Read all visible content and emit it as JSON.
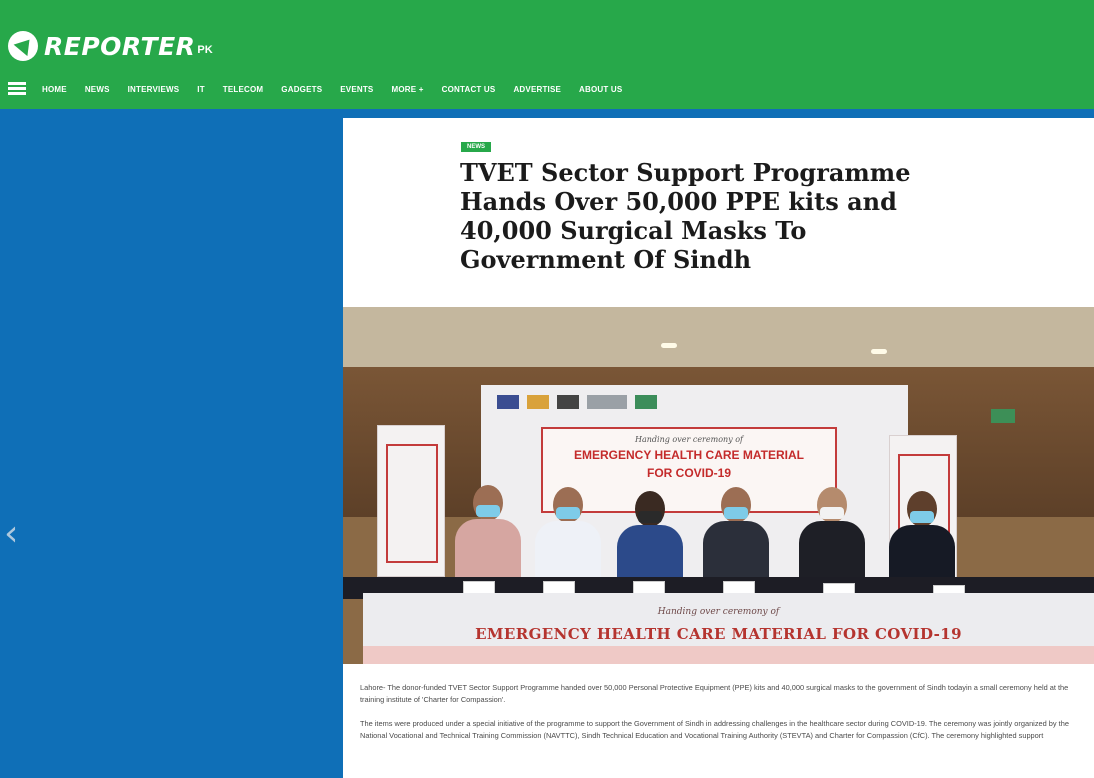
{
  "site": {
    "logo_text": "REPORTER",
    "logo_suffix": "PK"
  },
  "nav": {
    "items": [
      "HOME",
      "NEWS",
      "INTERVIEWS",
      "IT",
      "TELECOM",
      "GADGETS",
      "EVENTS",
      "MORE +",
      "CONTACT US",
      "ADVERTISE",
      "ABOUT US"
    ]
  },
  "article": {
    "category": "NEWS",
    "title": "TVET Sector Support Programme Hands Over 50,000 PPE kits and 40,000 Surgical Masks To Government Of Sindh",
    "paragraphs": [
      "Lahore- The donor-funded TVET Sector Support Programme handed over 50,000 Personal Protective Equipment (PPE) kits and 40,000 surgical masks to the government of Sindh todayin a small ceremony held at the training institute of 'Charter for Compassion'.",
      "The items were produced under a special initiative of the programme to support the Government of Sindh in addressing challenges in the healthcare sector during COVID-19. The ceremony was jointly organized by the National Vocational and Technical Training Commission (NAVTTC), Sindh Technical Education and Vocational Training Authority (STEVTA) and Charter for Compassion (CfC). The ceremony highlighted support"
    ]
  },
  "photo": {
    "backdrop_subtitle": "Handing over ceremony of",
    "backdrop_title_line1": "EMERGENCY HEALTH CARE MATERIAL",
    "backdrop_title_line2": "FOR COVID-19",
    "tablecloth_subtitle": "Handing over ceremony of",
    "tablecloth_title": "EMERGENCY HEALTH CARE MATERIAL FOR COVID-19"
  },
  "colors": {
    "header_green": "#27a84a",
    "left_panel_blue": "#0f6fb7",
    "banner_red": "#c42b2b"
  },
  "icons": {
    "menu": "hamburger-menu-icon",
    "prev": "chevron-left-icon"
  }
}
